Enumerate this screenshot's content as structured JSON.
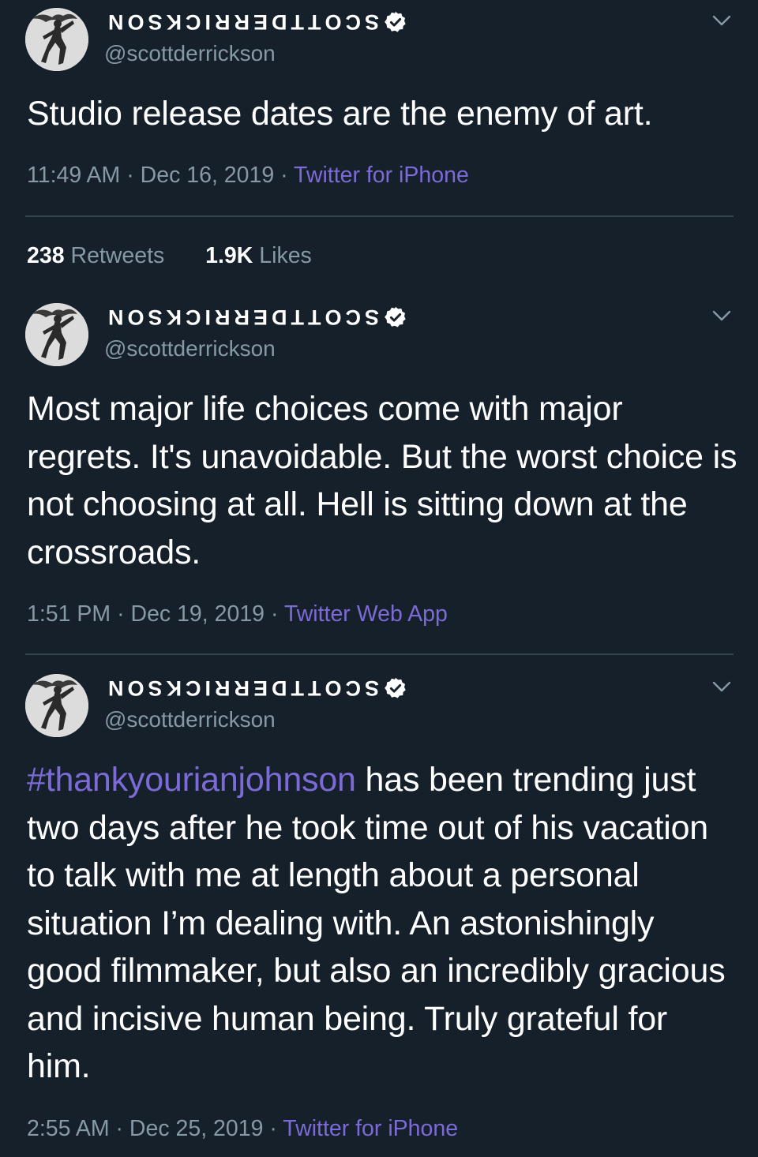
{
  "tweets": [
    {
      "display_name": "SCOTTDERRICKSON",
      "handle": "@scottderrickson",
      "text": "Studio release dates are the enemy of art.",
      "time": "11:49 AM",
      "date": "Dec 16, 2019",
      "source": "Twitter for iPhone"
    },
    {
      "display_name": "SCOTTDERRICKSON",
      "handle": "@scottderrickson",
      "text": "Most major life choices come with major regrets. It's unavoidable. But the worst choice is not choosing at all. Hell is sitting down at the crossroads.",
      "time": "1:51 PM",
      "date": "Dec 19, 2019",
      "source": "Twitter Web App"
    },
    {
      "display_name": "SCOTTDERRICKSON",
      "handle": "@scottderrickson",
      "hashtag": "#thankyourianjohnson",
      "text": " has been trending just two days after he took time out of his vacation to talk with me at length about a personal situation I’m dealing with. An astonishingly good filmmaker, but also an incredibly gracious and incisive human being. Truly grateful for him.",
      "time": "2:55 AM",
      "date": "Dec 25, 2019",
      "source": "Twitter for iPhone"
    }
  ],
  "stats": {
    "retweets_count": "238",
    "retweets_label": "Retweets",
    "likes_count": "1.9K",
    "likes_label": "Likes"
  },
  "separator": "·",
  "icons": {
    "verified": "verified-badge-icon",
    "menu": "chevron-down-icon"
  },
  "colors": {
    "background": "#15202b",
    "text": "#ffffff",
    "muted": "#8899a6",
    "accent": "#7c6bd6",
    "divider": "#38444d"
  }
}
